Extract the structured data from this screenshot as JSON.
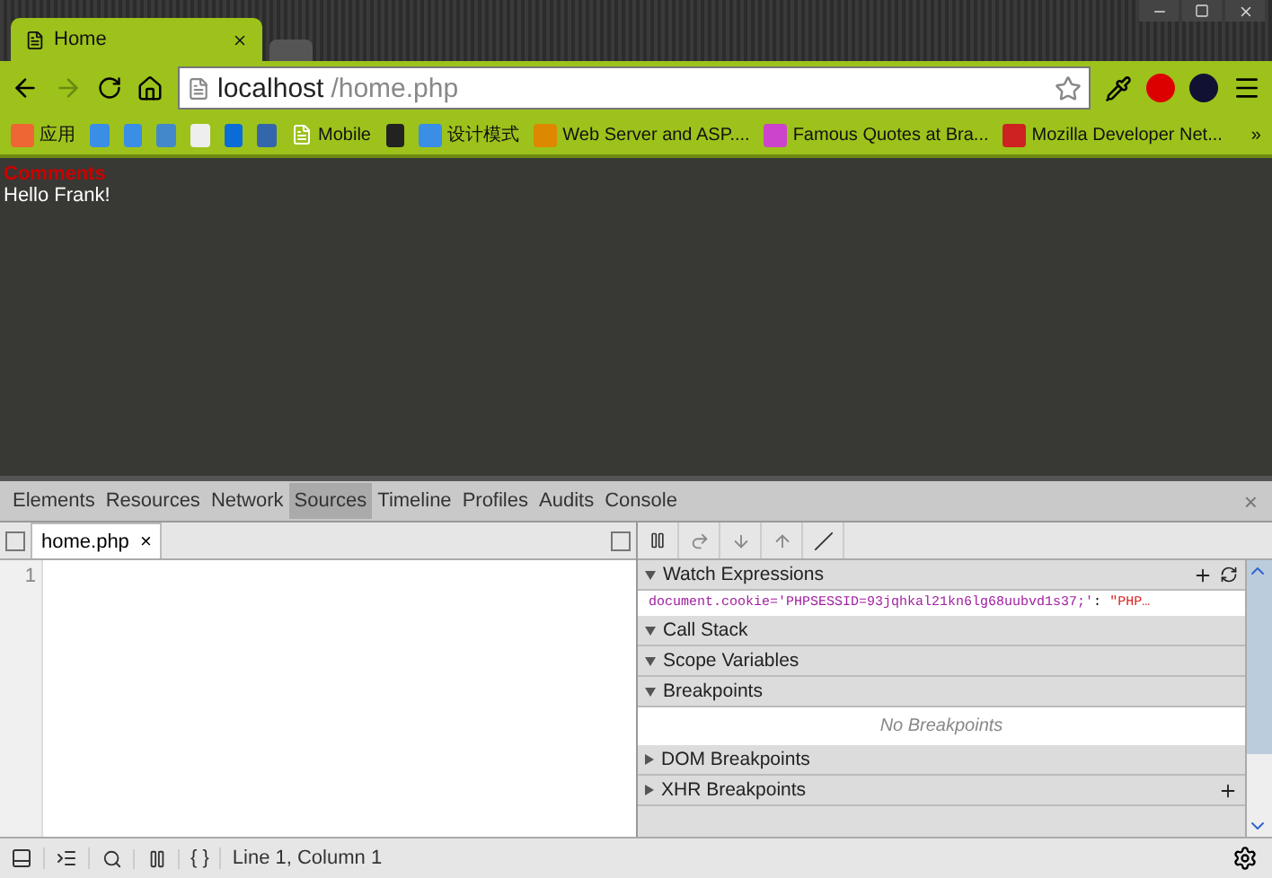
{
  "browser_tabs": [
    {
      "title": "Home",
      "selected": true
    }
  ],
  "address_bar": {
    "host": "localhost",
    "path": "/home.php"
  },
  "bookmarks": [
    {
      "label": "应用",
      "kind": "apps"
    },
    {
      "kind": "site"
    },
    {
      "kind": "site"
    },
    {
      "kind": "site"
    },
    {
      "kind": "site"
    },
    {
      "kind": "site"
    },
    {
      "kind": "site"
    },
    {
      "label": "Mobile",
      "kind": "page"
    },
    {
      "kind": "site"
    },
    {
      "label": "设计模式",
      "kind": "site"
    },
    {
      "label": "Web Server and ASP....",
      "kind": "site"
    },
    {
      "label": "Famous Quotes at Bra...",
      "kind": "site"
    },
    {
      "label": "Mozilla Developer Net...",
      "kind": "site"
    }
  ],
  "bookmarks_more": "»",
  "page": {
    "heading": "Comments",
    "text": "Hello Frank!"
  },
  "devtools_tabs": [
    {
      "label": "Elements",
      "selected": false
    },
    {
      "label": "Resources",
      "selected": false
    },
    {
      "label": "Network",
      "selected": false
    },
    {
      "label": "Sources",
      "selected": true
    },
    {
      "label": "Timeline",
      "selected": false
    },
    {
      "label": "Profiles",
      "selected": false
    },
    {
      "label": "Audits",
      "selected": false
    },
    {
      "label": "Console",
      "selected": false
    }
  ],
  "close": "×",
  "editor": {
    "file_tab": "home.php",
    "file_close": "×",
    "line_numbers": [
      "1"
    ]
  },
  "sidebar_sections": [
    {
      "title": "Watch Expressions",
      "expanded": true,
      "kind": "watch",
      "watches": [
        {
          "expression": "document.cookie='PHPSESSID=93jqhkal21kn6lg68uubvd1s37;'",
          "separator": ": ",
          "value": "\"PHP…"
        }
      ]
    },
    {
      "title": "Call Stack",
      "expanded": true,
      "kind": "plain"
    },
    {
      "title": "Scope Variables",
      "expanded": true,
      "kind": "plain"
    },
    {
      "title": "Breakpoints",
      "expanded": true,
      "kind": "empty",
      "message": "No Breakpoints"
    },
    {
      "title": "DOM Breakpoints",
      "expanded": false,
      "kind": "plain"
    },
    {
      "title": "XHR Breakpoints",
      "expanded": false,
      "kind": "add"
    }
  ],
  "status": {
    "braces": "{ }",
    "position": "Line 1, Column 1"
  }
}
